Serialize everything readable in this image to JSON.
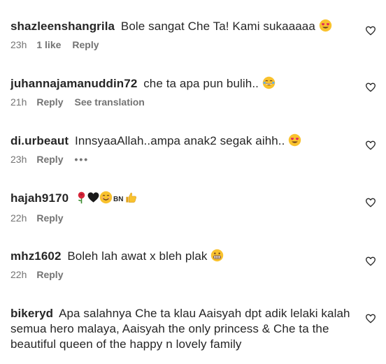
{
  "comments": [
    {
      "username": "shazleenshangrila",
      "text": "Bole sangat Che Ta! Kami sukaaaaa",
      "time": "23h",
      "likes": "1 like",
      "reply": "Reply"
    },
    {
      "username": "juhannajamanuddin72",
      "text": "che ta apa pun bulih..",
      "time": "21h",
      "reply": "Reply",
      "translation": "See translation"
    },
    {
      "username": "di.urbeaut",
      "text": "InnsyaaAllah..ampa anak2 segak aihh..",
      "time": "23h",
      "reply": "Reply",
      "more": "•••"
    },
    {
      "username": "hajah9170",
      "text": "",
      "bn": "BN",
      "time": "22h",
      "reply": "Reply"
    },
    {
      "username": "mhz1602",
      "text": "Boleh lah awat x bleh plak",
      "time": "22h",
      "reply": "Reply"
    },
    {
      "username": "bikeryd",
      "text": "Apa salahnya Che ta klau Aaisyah dpt adik lelaki kalah semua hero malaya, Aaisyah the only princess & Che ta the beautiful queen of the happy n lovely family"
    }
  ],
  "icons": {
    "heart": "heart-outline-icon",
    "heart_eyes": "heart-eyes-emoji",
    "laughing": "tears-of-joy-emoji",
    "rose": "rose-emoji",
    "black_heart": "black-heart-emoji",
    "smile": "smiling-face-emoji",
    "thumbs_up": "thumbs-up-emoji",
    "grimace": "grimacing-face-emoji"
  },
  "colors": {
    "text": "#262626",
    "meta": "#737373",
    "emoji_yellow": "#f9c22e"
  }
}
